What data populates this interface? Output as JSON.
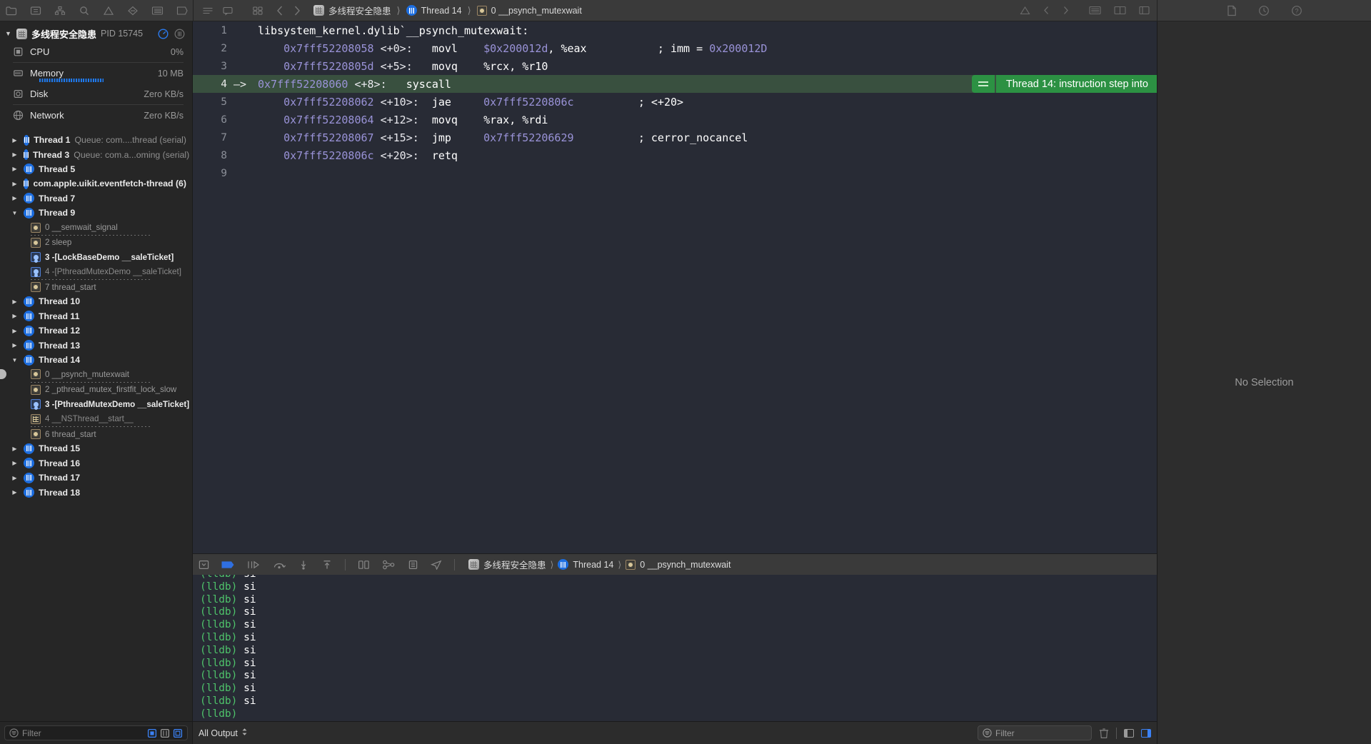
{
  "toolbar": {
    "left_icons": [
      "folder-icon",
      "warning-badge-icon",
      "hierarchy-icon",
      "search-icon",
      "issue-warning-icon",
      "test-icon",
      "debug-list-icon",
      "breakpoint-icon"
    ],
    "mid_icons": [
      "comment-icon",
      "library-icon"
    ],
    "back_label": "‹",
    "forward_label": "›",
    "breadcrumb": [
      {
        "icon": "app-chip-icon",
        "label": "多线程安全隐患"
      },
      {
        "icon": "thread-icon",
        "label": "Thread 14"
      },
      {
        "icon": "frame-icon",
        "label": "0 __psynch_mutexwait"
      }
    ],
    "right_icons": [
      "warning-triangle-icon",
      "chevron-left-icon",
      "chevron-right-icon",
      "inspector-left-icon",
      "inspector-right-icon",
      "panel-icon"
    ],
    "inspector_icons": [
      "file-inspector-icon",
      "history-inspector-icon",
      "quick-help-icon"
    ]
  },
  "navigator": {
    "process": {
      "name": "多线程安全隐患",
      "pid": "PID 15745",
      "icons": [
        "gauge-icon",
        "thread-icon"
      ]
    },
    "gauges": [
      {
        "icon": "cpu-icon",
        "label": "CPU",
        "value": "0%",
        "meter": false
      },
      {
        "icon": "memory-icon",
        "label": "Memory",
        "value": "10 MB",
        "meter": true
      },
      {
        "icon": "disk-icon",
        "label": "Disk",
        "value": "Zero KB/s",
        "meter": false
      },
      {
        "icon": "network-icon",
        "label": "Network",
        "value": "Zero KB/s",
        "meter": false
      }
    ],
    "threads": [
      {
        "kind": "thread",
        "expanded": false,
        "name": "Thread 1",
        "queue": "Queue: com....thread (serial)"
      },
      {
        "kind": "thread",
        "expanded": false,
        "name": "Thread 3",
        "queue": "Queue: com.a...oming (serial)"
      },
      {
        "kind": "thread",
        "expanded": false,
        "name": "Thread 5",
        "queue": ""
      },
      {
        "kind": "thread",
        "expanded": false,
        "name": "com.apple.uikit.eventfetch-thread (6)",
        "queue": ""
      },
      {
        "kind": "thread",
        "expanded": false,
        "name": "Thread 7",
        "queue": ""
      },
      {
        "kind": "thread",
        "expanded": true,
        "name": "Thread 9",
        "queue": ""
      },
      {
        "kind": "frame",
        "glyph": "frame-icon",
        "label": "0 __semwait_signal",
        "style": "dim",
        "sep_after": true
      },
      {
        "kind": "frame",
        "glyph": "frame-icon",
        "label": "2 sleep",
        "style": "dim",
        "sep_after": false
      },
      {
        "kind": "frame",
        "glyph": "object-icon",
        "label": "3 -[LockBaseDemo __saleTicket]",
        "style": "user",
        "sep_after": false
      },
      {
        "kind": "frame",
        "glyph": "object-icon",
        "label": "4 -[PthreadMutexDemo __saleTicket]",
        "style": "dim2",
        "sep_after": true
      },
      {
        "kind": "frame",
        "glyph": "frame-icon",
        "label": "7 thread_start",
        "style": "dim",
        "sep_after": false
      },
      {
        "kind": "thread",
        "expanded": false,
        "name": "Thread 10",
        "queue": ""
      },
      {
        "kind": "thread",
        "expanded": false,
        "name": "Thread 11",
        "queue": ""
      },
      {
        "kind": "thread",
        "expanded": false,
        "name": "Thread 12",
        "queue": ""
      },
      {
        "kind": "thread",
        "expanded": false,
        "name": "Thread 13",
        "queue": ""
      },
      {
        "kind": "thread",
        "expanded": true,
        "name": "Thread 14",
        "queue": ""
      },
      {
        "kind": "frame",
        "glyph": "frame-icon",
        "label": "0 __psynch_mutexwait",
        "style": "dim",
        "sep_after": true,
        "current": true
      },
      {
        "kind": "frame",
        "glyph": "frame-icon",
        "label": "2 _pthread_mutex_firstfit_lock_slow",
        "style": "dim",
        "sep_after": false
      },
      {
        "kind": "frame",
        "glyph": "object-icon",
        "label": "3 -[PthreadMutexDemo __saleTicket]",
        "style": "user",
        "sep_after": false
      },
      {
        "kind": "frame",
        "glyph": "grid-icon",
        "label": "4 __NSThread__start__",
        "style": "dim2",
        "sep_after": true
      },
      {
        "kind": "frame",
        "glyph": "frame-icon",
        "label": "6 thread_start",
        "style": "dim",
        "sep_after": false
      },
      {
        "kind": "thread",
        "expanded": false,
        "name": "Thread 15",
        "queue": ""
      },
      {
        "kind": "thread",
        "expanded": false,
        "name": "Thread 16",
        "queue": ""
      },
      {
        "kind": "thread",
        "expanded": false,
        "name": "Thread 17",
        "queue": ""
      },
      {
        "kind": "thread",
        "expanded": false,
        "name": "Thread 18",
        "queue": ""
      }
    ],
    "filter": {
      "placeholder": "Filter",
      "icon": "filter-icon",
      "buttons": [
        "show-only-stack-icon",
        "show-threads-icon",
        "show-queues-icon"
      ]
    }
  },
  "editor": {
    "lines": [
      {
        "n": "1",
        "arrow": "",
        "current": false,
        "parts": [
          {
            "t": "libsystem_kernel.dylib`__psynch_mutexwait:",
            "c": "c-hdr"
          }
        ]
      },
      {
        "n": "2",
        "arrow": "",
        "current": false,
        "parts": [
          {
            "t": "    ",
            "c": "c-op"
          },
          {
            "t": "0x7fff52208058 ",
            "c": "c-addr"
          },
          {
            "t": "<+0>:   ",
            "c": "c-off"
          },
          {
            "t": "movl    ",
            "c": "c-mn"
          },
          {
            "t": "$0x200012d",
            "c": "c-num"
          },
          {
            "t": ", %eax",
            "c": "c-op"
          },
          {
            "t": "           ; imm = ",
            "c": "c-cmt"
          },
          {
            "t": "0x200012D",
            "c": "c-num"
          }
        ]
      },
      {
        "n": "3",
        "arrow": "",
        "current": false,
        "parts": [
          {
            "t": "    ",
            "c": "c-op"
          },
          {
            "t": "0x7fff5220805d ",
            "c": "c-addr"
          },
          {
            "t": "<+5>:   ",
            "c": "c-off"
          },
          {
            "t": "movq    ",
            "c": "c-mn"
          },
          {
            "t": "%rcx, %r10",
            "c": "c-op"
          }
        ]
      },
      {
        "n": "4",
        "arrow": "–>",
        "current": true,
        "parts": [
          {
            "t": "0x7fff52208060 ",
            "c": "c-addr"
          },
          {
            "t": "<+8>:   ",
            "c": "c-off"
          },
          {
            "t": "syscall",
            "c": "c-mn"
          }
        ]
      },
      {
        "n": "5",
        "arrow": "",
        "current": false,
        "parts": [
          {
            "t": "    ",
            "c": "c-op"
          },
          {
            "t": "0x7fff52208062 ",
            "c": "c-addr"
          },
          {
            "t": "<+10>:  ",
            "c": "c-off"
          },
          {
            "t": "jae     ",
            "c": "c-mn"
          },
          {
            "t": "0x7fff5220806c",
            "c": "c-addr"
          },
          {
            "t": "          ; <+20>",
            "c": "c-cmt"
          }
        ]
      },
      {
        "n": "6",
        "arrow": "",
        "current": false,
        "parts": [
          {
            "t": "    ",
            "c": "c-op"
          },
          {
            "t": "0x7fff52208064 ",
            "c": "c-addr"
          },
          {
            "t": "<+12>:  ",
            "c": "c-off"
          },
          {
            "t": "movq    ",
            "c": "c-mn"
          },
          {
            "t": "%rax, %rdi",
            "c": "c-op"
          }
        ]
      },
      {
        "n": "7",
        "arrow": "",
        "current": false,
        "parts": [
          {
            "t": "    ",
            "c": "c-op"
          },
          {
            "t": "0x7fff52208067 ",
            "c": "c-addr"
          },
          {
            "t": "<+15>:  ",
            "c": "c-off"
          },
          {
            "t": "jmp     ",
            "c": "c-mn"
          },
          {
            "t": "0x7fff52206629",
            "c": "c-addr"
          },
          {
            "t": "          ; cerror_nocancel",
            "c": "c-cmt"
          }
        ]
      },
      {
        "n": "8",
        "arrow": "",
        "current": false,
        "parts": [
          {
            "t": "    ",
            "c": "c-op"
          },
          {
            "t": "0x7fff5220806c ",
            "c": "c-addr"
          },
          {
            "t": "<+20>:  ",
            "c": "c-off"
          },
          {
            "t": "retq",
            "c": "c-mn"
          }
        ]
      },
      {
        "n": "9",
        "arrow": "",
        "current": false,
        "parts": []
      }
    ],
    "annotation": {
      "badge": "=",
      "text": "Thread 14: instruction step into",
      "color": "#2c9143",
      "line": 4
    }
  },
  "debugbar": {
    "icons": [
      "hide-debug-area-icon",
      "breakpoints-toggle-icon",
      "continue-icon",
      "step-over-icon",
      "step-into-icon",
      "step-out-icon",
      "simulate-location-icon",
      "view-hierarchy-icon",
      "memory-graph-icon",
      "location-icon"
    ],
    "breadcrumb": [
      {
        "icon": "app-chip-icon",
        "label": "多线程安全隐患"
      },
      {
        "icon": "thread-icon",
        "label": "Thread 14"
      },
      {
        "icon": "frame-icon",
        "label": "0 __psynch_mutexwait"
      }
    ]
  },
  "console": {
    "lines": [
      {
        "prompt": "(lldb)",
        "cmd": " si",
        "clipped": true
      },
      {
        "prompt": "(lldb)",
        "cmd": " si"
      },
      {
        "prompt": "(lldb)",
        "cmd": " si"
      },
      {
        "prompt": "(lldb)",
        "cmd": " si"
      },
      {
        "prompt": "(lldb)",
        "cmd": " si"
      },
      {
        "prompt": "(lldb)",
        "cmd": " si"
      },
      {
        "prompt": "(lldb)",
        "cmd": " si"
      },
      {
        "prompt": "(lldb)",
        "cmd": " si"
      },
      {
        "prompt": "(lldb)",
        "cmd": " si"
      },
      {
        "prompt": "(lldb)",
        "cmd": " si"
      },
      {
        "prompt": "(lldb)",
        "cmd": " si"
      },
      {
        "prompt": "(lldb)",
        "cmd": ""
      }
    ]
  },
  "consolebar": {
    "output_selector": "All Output",
    "filter_placeholder": "Filter",
    "icons": [
      "trash-icon",
      "show-console-only-icon",
      "show-variables-and-console-icon"
    ]
  },
  "inspector": {
    "empty_label": "No Selection"
  },
  "colors": {
    "accent": "#3b82f7",
    "current_line": "#39503f",
    "annotation": "#2c9143",
    "prompt_green": "#4ec26a",
    "addr_purple": "#9a93d8"
  }
}
